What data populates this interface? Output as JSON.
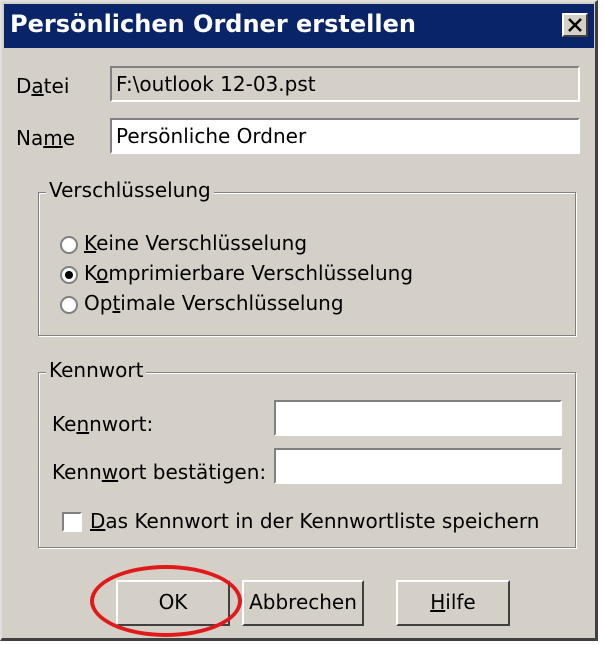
{
  "window": {
    "title": "Persönlichen Ordner erstellen"
  },
  "file": {
    "label_pre": "D",
    "label_mn": "a",
    "label_post": "tei",
    "value": "F:\\outlook 12-03.pst"
  },
  "name": {
    "label_pre": "Na",
    "label_mn": "m",
    "label_post": "e",
    "value": "Persönliche Ordner"
  },
  "encryption": {
    "legend": "Verschlüsselung",
    "options": [
      {
        "pre": "",
        "mn": "K",
        "post": "eine Verschlüsselung",
        "selected": false
      },
      {
        "pre": "K",
        "mn": "o",
        "post": "mprimierbare Verschlüsselung",
        "selected": true
      },
      {
        "pre": "Op",
        "mn": "t",
        "post": "imale Verschlüsselung",
        "selected": false
      }
    ]
  },
  "password": {
    "legend": "Kennwort",
    "pw_label_pre": "Ke",
    "pw_label_mn": "n",
    "pw_label_post": "nwort:",
    "confirm_label_pre": "Kenn",
    "confirm_label_mn": "w",
    "confirm_label_post": "ort bestätigen:",
    "pw_value": "",
    "confirm_value": "",
    "save_pre": "",
    "save_mn": "D",
    "save_post": "as Kennwort in der Kennwortliste speichern",
    "save_checked": false
  },
  "buttons": {
    "ok": "OK",
    "cancel": "Abbrechen",
    "help_mn": "H",
    "help_post": "ilfe"
  },
  "colors": {
    "titlebar": "#0a246a",
    "face": "#d4d0c8",
    "highlight_ellipse": "#e01a1a"
  }
}
